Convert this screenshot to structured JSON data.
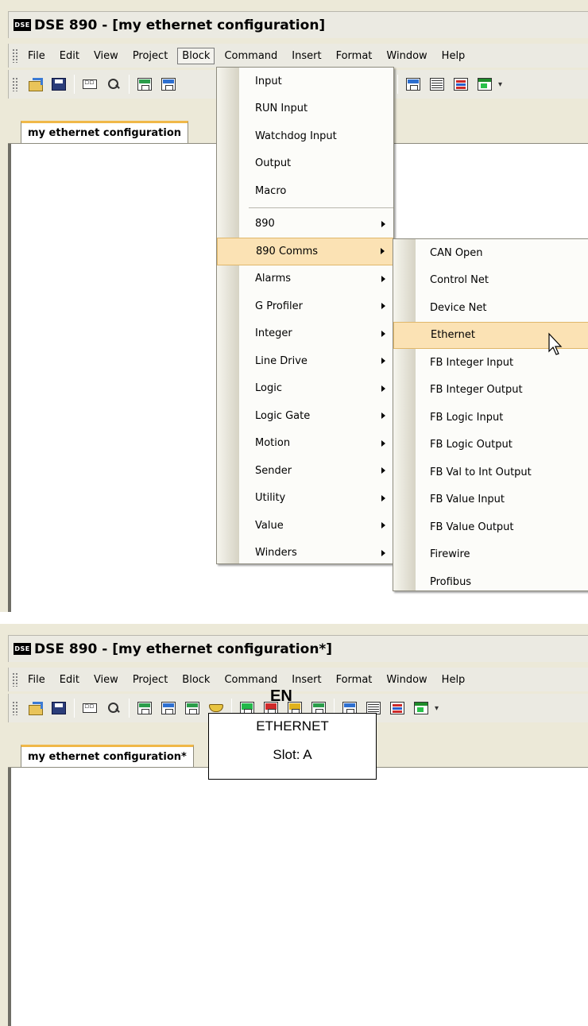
{
  "screen1": {
    "title": "DSE 890 - [my ethernet configuration]",
    "app_icon": "DSE",
    "menubar": [
      "File",
      "Edit",
      "View",
      "Project",
      "Block",
      "Command",
      "Insert",
      "Format",
      "Window",
      "Help"
    ],
    "active_menu": "Block",
    "tab": "my ethernet configuration",
    "block_menu": {
      "top_items": [
        "Input",
        "RUN Input",
        "Watchdog Input",
        "Output",
        "Macro"
      ],
      "sub_items": [
        "890",
        "890 Comms",
        "Alarms",
        "G Profiler",
        "Integer",
        "Line Drive",
        "Logic",
        "Logic Gate",
        "Motion",
        "Sender",
        "Utility",
        "Value",
        "Winders"
      ],
      "highlighted": "890 Comms"
    },
    "comms_submenu": {
      "items": [
        "CAN Open",
        "Control Net",
        "Device Net",
        "Ethernet",
        "FB Integer Input",
        "FB Integer Output",
        "FB Logic Input",
        "FB Logic Output",
        "FB Val to Int Output",
        "FB Value Input",
        "FB Value Output",
        "Firewire",
        "Profibus"
      ],
      "highlighted": "Ethernet"
    }
  },
  "screen2": {
    "title": "DSE 890 - [my ethernet configuration*]",
    "app_icon": "DSE",
    "menubar": [
      "File",
      "Edit",
      "View",
      "Project",
      "Block",
      "Command",
      "Insert",
      "Format",
      "Window",
      "Help"
    ],
    "tab": "my ethernet configuration*",
    "block": {
      "tag": "EN",
      "name": "ETHERNET",
      "slot": "Slot: A"
    }
  },
  "icons": [
    "open-folder-icon",
    "save-icon",
    "properties-icon",
    "find-icon",
    "block-icon",
    "connector-icon",
    "table-icon",
    "window-icon"
  ],
  "colors": {
    "tab_accent": "#f0b848",
    "menu_highlight": "#fbe2b4"
  }
}
